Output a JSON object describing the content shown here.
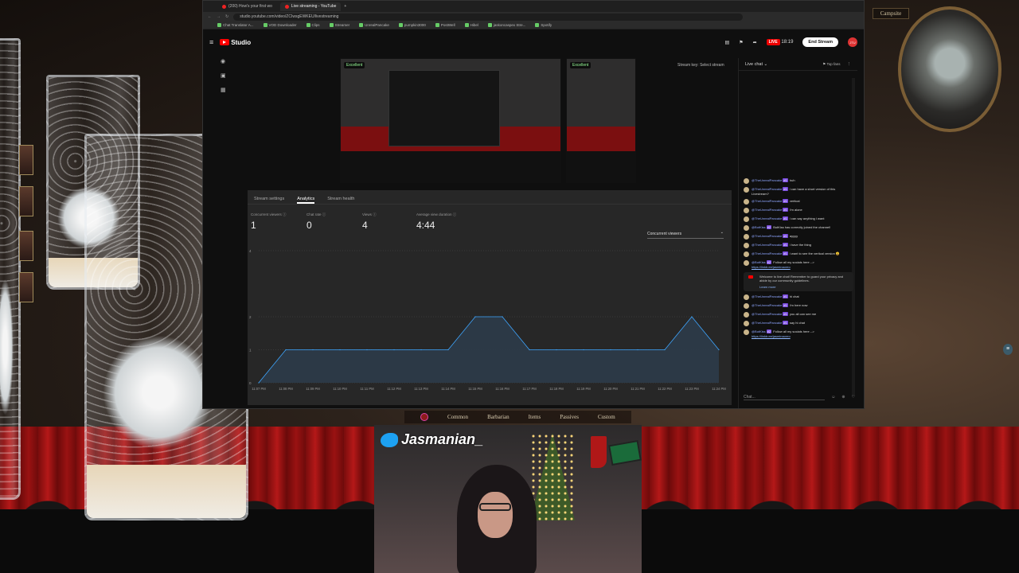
{
  "browser": {
    "tabs": [
      {
        "label": "(200) How's your first wo"
      },
      {
        "label": "Live streaming - YouTube"
      }
    ],
    "url": "studio.youtube.com/video/ZCIwsgEWKEU/livestreaming",
    "bookmarks": [
      "Chat Translator A...",
      "VOD Downloader",
      "Clips",
      "Streamer",
      "UnrealPancake",
      "pumpkin3000",
      "PostWell",
      "Hibel",
      "jaskoncaspex Stre...",
      "Spotify"
    ]
  },
  "studio": {
    "logo": "Studio",
    "live_badge": "LIVE",
    "live_time": "18:19",
    "end_stream": "End Stream",
    "avatar_text": "JTU",
    "preview_badge": "Excellent",
    "preview_badge2": "Excellent",
    "stream_key_label": "Stream key: Select stream",
    "tabs": [
      "Stream settings",
      "Analytics",
      "Stream health"
    ],
    "stats": [
      {
        "label": "Concurrent viewers",
        "value": "1"
      },
      {
        "label": "Chat rate",
        "value": "0"
      },
      {
        "label": "Views",
        "value": "4"
      },
      {
        "label": "Average view duration",
        "value": "4:44"
      }
    ],
    "metric_select": "Concurrent viewers"
  },
  "chart_data": {
    "type": "area",
    "x": [
      "11:07 PM",
      "11:08 PM",
      "11:09 PM",
      "11:10 PM",
      "11:11 PM",
      "11:12 PM",
      "11:13 PM",
      "11:14 PM",
      "11:15 PM",
      "11:16 PM",
      "11:17 PM",
      "11:18 PM",
      "11:19 PM",
      "11:20 PM",
      "11:21 PM",
      "11:22 PM",
      "11:23 PM",
      "11:24 PM"
    ],
    "values": [
      0,
      1,
      1,
      1,
      1,
      1,
      1,
      1,
      2,
      2,
      1,
      1,
      1,
      1,
      1,
      1,
      2,
      1
    ],
    "yticks": [
      "0",
      "1",
      "2",
      "4"
    ],
    "ylim": [
      0,
      4
    ],
    "grid": true,
    "colors": {
      "line": "#3ea6ff",
      "fill": "#2d3c4a"
    }
  },
  "chat": {
    "title": "Live chat",
    "top_fans": "Top fans",
    "messages": [
      {
        "name": "@TheUnrealPancake",
        "badge": "#1",
        "text": "huh"
      },
      {
        "name": "@TheUnrealPancake",
        "badge": "#1",
        "text": "i can have a short version of this Livestream?"
      },
      {
        "name": "@TheUnrealPancake",
        "badge": "#1",
        "text": "vertical"
      },
      {
        "name": "@TheUnrealPancake",
        "badge": "#1",
        "text": "i'm alone"
      },
      {
        "name": "@TheUnrealPancake",
        "badge": "#1",
        "text": "i can say anything i want"
      },
      {
        "name": "@BotKiss",
        "badge": "#2",
        "text": "BotKiss has correctly joined the channel!"
      },
      {
        "name": "@TheUnrealPancake",
        "badge": "#1",
        "text": "ayyyy"
      },
      {
        "name": "@TheUnrealPancake",
        "badge": "#1",
        "text": "i have the thing"
      },
      {
        "name": "@TheUnrealPancake",
        "badge": "#1",
        "text": "i want to see the vertical version 😀"
      },
      {
        "name": "@BotKiss",
        "badge": "#2",
        "text": "Follow all my socials here --> ",
        "link": "https://linktr.ee/jasminaoreo"
      }
    ],
    "notice": "Welcome to live chat! Remember to guard your privacy and abide by our community guidelines.",
    "notice_link": "Learn more",
    "messages2": [
      {
        "name": "@TheUnrealPancake",
        "badge": "#1",
        "text": "hi chat"
      },
      {
        "name": "@TheUnrealPancake",
        "badge": "#1",
        "text": "i'm here now"
      },
      {
        "name": "@TheUnrealPancake",
        "badge": "#1",
        "text": "you all can see me"
      },
      {
        "name": "@TheUnrealPancake",
        "badge": "#1",
        "text": "say hi chat"
      },
      {
        "name": "@BotKiss",
        "badge": "#2",
        "text": "Follow all my socials here --> ",
        "link": "https://linktr.ee/jasminaoreo"
      }
    ],
    "input_placeholder": "Chat..."
  },
  "game": {
    "campsite": "Campsite",
    "hotbar": [
      "Common",
      "Barbarian",
      "Items",
      "Passives",
      "Custom"
    ]
  },
  "webcam": {
    "twitter": "Jasmanian_"
  }
}
